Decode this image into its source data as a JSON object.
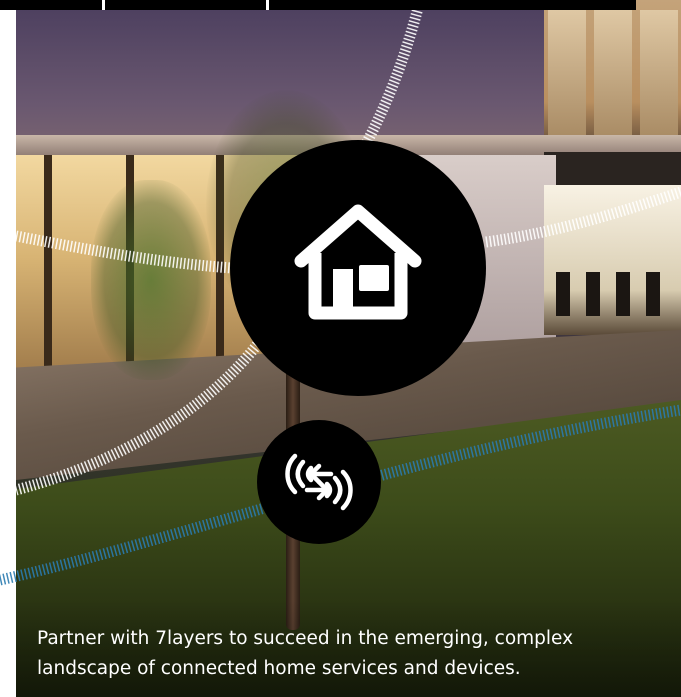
{
  "hero": {
    "caption": "Partner with 7layers to succeed in the emerging, complex landscape of connected home services and devices.",
    "home_icon": "home-icon",
    "nfc_icon": "nfc-exchange-icon"
  },
  "colors": {
    "circle": "#000000",
    "dash_white": "#ffffff",
    "dash_blue": "#2a7bb0",
    "caption_text": "#ffffff"
  }
}
